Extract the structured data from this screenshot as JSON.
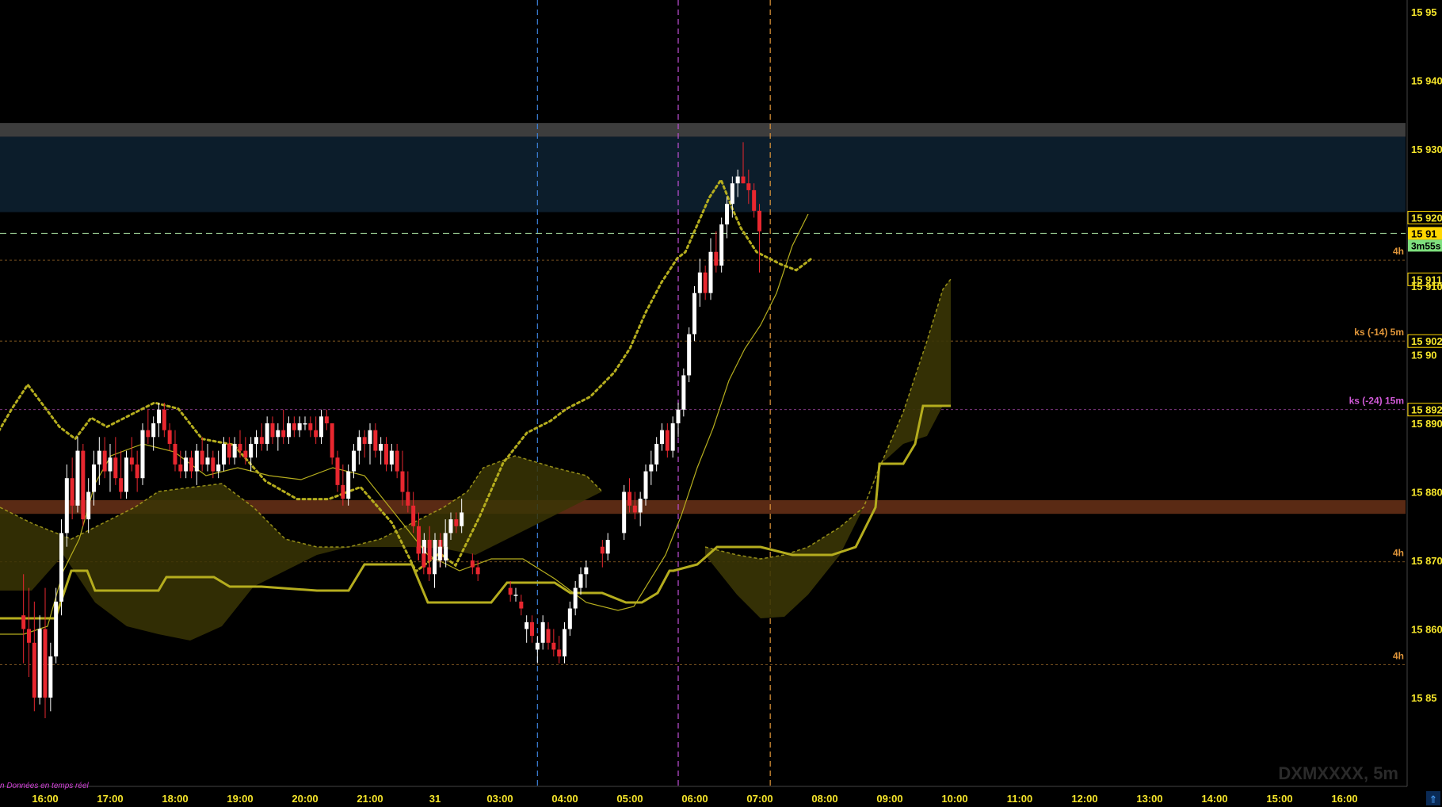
{
  "chart_data": {
    "type": "candlestick",
    "symbol_watermark": "DXMXXXX, 5m",
    "status_text": "n  Données en temps réel",
    "countdown": "3m55s",
    "colors": {
      "background": "#000000",
      "bull": "#ffffff",
      "bear": "#e8272f",
      "ichimoku": "#b5ad1e",
      "cloud": "#3a3505",
      "axis_text": "#f5e52a",
      "price_box": "#ffd700",
      "countdown_bg": "#7ee07e",
      "resistance_zone": "#0c1d2b",
      "resistance_band": "#3d3d3d",
      "support_band": "#5a2a14",
      "marker_blue": "#3b7fd6",
      "marker_magenta": "#c24fd8",
      "marker_orange": "#e0963a",
      "level_orange": "#e0963a",
      "level_magenta": "#d15ad8",
      "current_price_line": "#a8e0a0"
    },
    "y_range": [
      15843,
      15957
    ],
    "y_ticks": [
      {
        "value": 15950,
        "label": "15 95"
      },
      {
        "value": 15940,
        "label": "15 940"
      },
      {
        "value": 15930,
        "label": "15 930"
      },
      {
        "value": 15900,
        "label": "15 90"
      },
      {
        "value": 15890,
        "label": "15 890"
      },
      {
        "value": 15880,
        "label": "15 880"
      },
      {
        "value": 15870,
        "label": "15 870"
      },
      {
        "value": 15860,
        "label": "15 860"
      },
      {
        "value": 15850,
        "label": "15 85"
      }
    ],
    "x_ticks": [
      "16:00",
      "17:00",
      "18:00",
      "19:00",
      "20:00",
      "21:00",
      "31",
      "03:00",
      "04:00",
      "05:00",
      "06:00",
      "07:00",
      "08:00",
      "09:00",
      "10:00",
      "11:00",
      "12:00",
      "13:00",
      "14:00",
      "15:00",
      "16:00"
    ],
    "price_boxes": [
      {
        "value": 15920,
        "label": "15 920",
        "style": "outline"
      },
      {
        "value": 15917.7,
        "label": "15 91",
        "style": "current"
      },
      {
        "value": 15911,
        "label": "15 911",
        "style": "outline"
      },
      {
        "value": 15910,
        "label": "15 910",
        "style": "plain"
      },
      {
        "value": 15902,
        "label": "15 902",
        "style": "outline"
      },
      {
        "value": 15892,
        "label": "15 892",
        "style": "outline"
      }
    ],
    "levels": [
      {
        "value": 15913.8,
        "label": "4h",
        "color": "orange"
      },
      {
        "value": 15902,
        "label": "ks (-14) 5m",
        "color": "orange"
      },
      {
        "value": 15892,
        "label": "ks (-24) 15m",
        "color": "magenta"
      },
      {
        "value": 15869.8,
        "label": "4h",
        "color": "orange"
      },
      {
        "value": 15854.8,
        "label": "4h",
        "color": "orange"
      }
    ],
    "zones": [
      {
        "from": 15920.8,
        "to": 15931.8,
        "kind": "resistance_zone"
      },
      {
        "from": 15931.8,
        "to": 15933.8,
        "kind": "resistance_band"
      },
      {
        "from": 15876.8,
        "to": 15878.8,
        "kind": "support_band"
      }
    ],
    "vertical_markers": [
      {
        "time": "03:50",
        "color": "blue"
      },
      {
        "time": "06:00",
        "color": "magenta"
      },
      {
        "time": "07:25",
        "color": "orange"
      }
    ],
    "candles": [
      {
        "t": "15:40",
        "o": 15862,
        "h": 15868,
        "l": 15855,
        "c": 15860
      },
      {
        "t": "15:45",
        "o": 15860,
        "h": 15866,
        "l": 15853,
        "c": 15858
      },
      {
        "t": "15:50",
        "o": 15858,
        "h": 15864,
        "l": 15848,
        "c": 15850
      },
      {
        "t": "15:55",
        "o": 15850,
        "h": 15862,
        "l": 15849,
        "c": 15860
      },
      {
        "t": "16:00",
        "o": 15860,
        "h": 15866,
        "l": 15847,
        "c": 15850
      },
      {
        "t": "16:05",
        "o": 15850,
        "h": 15858,
        "l": 15848,
        "c": 15856
      },
      {
        "t": "16:10",
        "o": 15856,
        "h": 15866,
        "l": 15855,
        "c": 15864
      },
      {
        "t": "16:15",
        "o": 15864,
        "h": 15876,
        "l": 15862,
        "c": 15874
      },
      {
        "t": "16:20",
        "o": 15874,
        "h": 15884,
        "l": 15872,
        "c": 15882
      },
      {
        "t": "16:25",
        "o": 15882,
        "h": 15885,
        "l": 15876,
        "c": 15878
      },
      {
        "t": "16:30",
        "o": 15878,
        "h": 15888,
        "l": 15877,
        "c": 15886
      },
      {
        "t": "16:35",
        "o": 15886,
        "h": 15887,
        "l": 15875,
        "c": 15876
      },
      {
        "t": "16:40",
        "o": 15876,
        "h": 15882,
        "l": 15874,
        "c": 15880
      },
      {
        "t": "16:45",
        "o": 15880,
        "h": 15886,
        "l": 15878,
        "c": 15884
      },
      {
        "t": "16:50",
        "o": 15884,
        "h": 15888,
        "l": 15881,
        "c": 15886
      },
      {
        "t": "16:55",
        "o": 15886,
        "h": 15888,
        "l": 15882,
        "c": 15883
      },
      {
        "t": "17:00",
        "o": 15883,
        "h": 15887,
        "l": 15880,
        "c": 15885
      },
      {
        "t": "17:05",
        "o": 15885,
        "h": 15888,
        "l": 15881,
        "c": 15882
      },
      {
        "t": "17:10",
        "o": 15882,
        "h": 15886,
        "l": 15879,
        "c": 15880
      },
      {
        "t": "17:15",
        "o": 15880,
        "h": 15886,
        "l": 15879,
        "c": 15885
      },
      {
        "t": "17:20",
        "o": 15885,
        "h": 15888,
        "l": 15883,
        "c": 15884
      },
      {
        "t": "17:25",
        "o": 15884,
        "h": 15886,
        "l": 15880,
        "c": 15882
      },
      {
        "t": "17:30",
        "o": 15882,
        "h": 15890,
        "l": 15881,
        "c": 15889
      },
      {
        "t": "17:35",
        "o": 15889,
        "h": 15892,
        "l": 15887,
        "c": 15888
      },
      {
        "t": "17:40",
        "o": 15888,
        "h": 15891,
        "l": 15886,
        "c": 15890
      },
      {
        "t": "17:45",
        "o": 15890,
        "h": 15893,
        "l": 15888,
        "c": 15892
      },
      {
        "t": "17:50",
        "o": 15892,
        "h": 15893,
        "l": 15888,
        "c": 15889
      },
      {
        "t": "17:55",
        "o": 15889,
        "h": 15890,
        "l": 15886,
        "c": 15887
      },
      {
        "t": "18:00",
        "o": 15887,
        "h": 15889,
        "l": 15883,
        "c": 15884
      },
      {
        "t": "18:05",
        "o": 15884,
        "h": 15886,
        "l": 15882,
        "c": 15883
      },
      {
        "t": "18:10",
        "o": 15883,
        "h": 15886,
        "l": 15882,
        "c": 15885
      },
      {
        "t": "18:15",
        "o": 15885,
        "h": 15886,
        "l": 15882,
        "c": 15883
      },
      {
        "t": "18:20",
        "o": 15883,
        "h": 15887,
        "l": 15881,
        "c": 15886
      },
      {
        "t": "18:25",
        "o": 15886,
        "h": 15888,
        "l": 15883,
        "c": 15884
      },
      {
        "t": "18:30",
        "o": 15884,
        "h": 15887,
        "l": 15883,
        "c": 15885
      },
      {
        "t": "18:35",
        "o": 15885,
        "h": 15886,
        "l": 15882,
        "c": 15883
      },
      {
        "t": "18:40",
        "o": 15883,
        "h": 15886,
        "l": 15882,
        "c": 15884
      },
      {
        "t": "18:45",
        "o": 15884,
        "h": 15888,
        "l": 15883,
        "c": 15887
      },
      {
        "t": "18:50",
        "o": 15887,
        "h": 15888,
        "l": 15884,
        "c": 15885
      },
      {
        "t": "18:55",
        "o": 15885,
        "h": 15888,
        "l": 15884,
        "c": 15887
      },
      {
        "t": "19:00",
        "o": 15887,
        "h": 15889,
        "l": 15885,
        "c": 15886
      },
      {
        "t": "19:05",
        "o": 15886,
        "h": 15888,
        "l": 15884,
        "c": 15885
      },
      {
        "t": "19:10",
        "o": 15885,
        "h": 15888,
        "l": 15883,
        "c": 15887
      },
      {
        "t": "19:15",
        "o": 15887,
        "h": 15889,
        "l": 15885,
        "c": 15888
      },
      {
        "t": "19:20",
        "o": 15888,
        "h": 15890,
        "l": 15886,
        "c": 15887
      },
      {
        "t": "19:25",
        "o": 15887,
        "h": 15891,
        "l": 15886,
        "c": 15890
      },
      {
        "t": "19:30",
        "o": 15890,
        "h": 15891,
        "l": 15887,
        "c": 15888
      },
      {
        "t": "19:35",
        "o": 15888,
        "h": 15890,
        "l": 15886,
        "c": 15889
      },
      {
        "t": "19:40",
        "o": 15889,
        "h": 15892,
        "l": 15887,
        "c": 15888
      },
      {
        "t": "19:45",
        "o": 15888,
        "h": 15891,
        "l": 15887,
        "c": 15890
      },
      {
        "t": "19:50",
        "o": 15890,
        "h": 15891,
        "l": 15888,
        "c": 15889
      },
      {
        "t": "19:55",
        "o": 15889,
        "h": 15891,
        "l": 15888,
        "c": 15890
      },
      {
        "t": "20:00",
        "o": 15890,
        "h": 15891,
        "l": 15889,
        "c": 15890
      },
      {
        "t": "20:05",
        "o": 15890,
        "h": 15891,
        "l": 15888,
        "c": 15889
      },
      {
        "t": "20:10",
        "o": 15889,
        "h": 15891,
        "l": 15887,
        "c": 15888
      },
      {
        "t": "20:15",
        "o": 15888,
        "h": 15892,
        "l": 15887,
        "c": 15891
      },
      {
        "t": "20:20",
        "o": 15891,
        "h": 15892,
        "l": 15889,
        "c": 15890
      },
      {
        "t": "20:25",
        "o": 15890,
        "h": 15890,
        "l": 15884,
        "c": 15885
      },
      {
        "t": "20:30",
        "o": 15885,
        "h": 15886,
        "l": 15880,
        "c": 15881
      },
      {
        "t": "20:35",
        "o": 15881,
        "h": 15884,
        "l": 15878,
        "c": 15879
      },
      {
        "t": "20:40",
        "o": 15879,
        "h": 15884,
        "l": 15878,
        "c": 15883
      },
      {
        "t": "20:45",
        "o": 15883,
        "h": 15887,
        "l": 15882,
        "c": 15886
      },
      {
        "t": "20:50",
        "o": 15886,
        "h": 15889,
        "l": 15884,
        "c": 15888
      },
      {
        "t": "20:55",
        "o": 15888,
        "h": 15889,
        "l": 15885,
        "c": 15887
      },
      {
        "t": "21:00",
        "o": 15887,
        "h": 15890,
        "l": 15884,
        "c": 15889
      },
      {
        "t": "21:05",
        "o": 15889,
        "h": 15890,
        "l": 15885,
        "c": 15886
      },
      {
        "t": "21:10",
        "o": 15886,
        "h": 15888,
        "l": 15884,
        "c": 15887
      },
      {
        "t": "21:15",
        "o": 15887,
        "h": 15888,
        "l": 15883,
        "c": 15884
      },
      {
        "t": "21:20",
        "o": 15884,
        "h": 15887,
        "l": 15883,
        "c": 15886
      },
      {
        "t": "21:25",
        "o": 15886,
        "h": 15887,
        "l": 15882,
        "c": 15883
      },
      {
        "t": "21:30",
        "o": 15883,
        "h": 15886,
        "l": 15878,
        "c": 15880
      },
      {
        "t": "21:35",
        "o": 15880,
        "h": 15883,
        "l": 15877,
        "c": 15878
      },
      {
        "t": "21:40",
        "o": 15878,
        "h": 15880,
        "l": 15874,
        "c": 15875
      },
      {
        "t": "21:45",
        "o": 15875,
        "h": 15877,
        "l": 15870,
        "c": 15871
      },
      {
        "t": "21:50",
        "o": 15871,
        "h": 15874,
        "l": 15869,
        "c": 15873
      },
      {
        "t": "21:55",
        "o": 15873,
        "h": 15875,
        "l": 15869,
        "c": 15870
      },
      {
        "t": "22:00",
        "o": 15870,
        "h": 15874,
        "l": 15869,
        "c": 15873
      },
      {
        "t": "22:05",
        "o": 15873,
        "h": 15874,
        "l": 15869,
        "c": 15870
      },
      {
        "t": "22:10",
        "o": 15870,
        "h": 15873,
        "l": 15869,
        "c": 15872
      },
      {
        "t": "02:00",
        "o": 15872,
        "h": 15874,
        "l": 15870,
        "c": 15871
      },
      {
        "t": "02:05",
        "o": 15871,
        "h": 15872,
        "l": 15868,
        "c": 15869
      },
      {
        "t": "02:10",
        "o": 15869,
        "h": 15871,
        "l": 15867,
        "c": 15868
      },
      {
        "t": "02:15",
        "o": 15868,
        "h": 15871,
        "l": 15866,
        "c": 15870
      },
      {
        "t": "02:20",
        "o": 15870,
        "h": 15873,
        "l": 15869,
        "c": 15872
      },
      {
        "t": "02:25",
        "o": 15872,
        "h": 15876,
        "l": 15871,
        "c": 15874
      },
      {
        "t": "02:30",
        "o": 15874,
        "h": 15877,
        "l": 15873,
        "c": 15876
      },
      {
        "t": "02:35",
        "o": 15876,
        "h": 15877,
        "l": 15874,
        "c": 15875
      },
      {
        "t": "02:40",
        "o": 15875,
        "h": 15879,
        "l": 15874,
        "c": 15877
      },
      {
        "t": "02:50",
        "o": 15870,
        "h": 15871,
        "l": 15868,
        "c": 15869
      },
      {
        "t": "02:55",
        "o": 15869,
        "h": 15870,
        "l": 15867,
        "c": 15868
      },
      {
        "t": "03:25",
        "o": 15866,
        "h": 15867,
        "l": 15864,
        "c": 15865
      },
      {
        "t": "03:30",
        "o": 15865,
        "h": 15866,
        "l": 15864,
        "c": 15865
      },
      {
        "t": "03:35",
        "o": 15864,
        "h": 15865,
        "l": 15862,
        "c": 15863
      },
      {
        "t": "03:40",
        "o": 15860,
        "h": 15862,
        "l": 15858,
        "c": 15861
      },
      {
        "t": "03:45",
        "o": 15861,
        "h": 15862,
        "l": 15858,
        "c": 15859
      },
      {
        "t": "03:50",
        "o": 15857,
        "h": 15859,
        "l": 15855,
        "c": 15858
      },
      {
        "t": "03:55",
        "o": 15858,
        "h": 15862,
        "l": 15857,
        "c": 15861
      },
      {
        "t": "04:00",
        "o": 15860,
        "h": 15861,
        "l": 15857,
        "c": 15858
      },
      {
        "t": "04:05",
        "o": 15858,
        "h": 15860,
        "l": 15856,
        "c": 15857
      },
      {
        "t": "04:10",
        "o": 15857,
        "h": 15859,
        "l": 15855,
        "c": 15856
      },
      {
        "t": "04:15",
        "o": 15856,
        "h": 15861,
        "l": 15855,
        "c": 15860
      },
      {
        "t": "04:20",
        "o": 15860,
        "h": 15864,
        "l": 15859,
        "c": 15863
      },
      {
        "t": "04:25",
        "o": 15863,
        "h": 15867,
        "l": 15862,
        "c": 15866
      },
      {
        "t": "04:30",
        "o": 15866,
        "h": 15869,
        "l": 15865,
        "c": 15868
      },
      {
        "t": "04:35",
        "o": 15868,
        "h": 15870,
        "l": 15866,
        "c": 15869
      },
      {
        "t": "04:50",
        "o": 15872,
        "h": 15873,
        "l": 15869,
        "c": 15871
      },
      {
        "t": "04:55",
        "o": 15871,
        "h": 15874,
        "l": 15870,
        "c": 15873
      },
      {
        "t": "05:10",
        "o": 15874,
        "h": 15881,
        "l": 15873,
        "c": 15880
      },
      {
        "t": "05:15",
        "o": 15880,
        "h": 15882,
        "l": 15877,
        "c": 15878
      },
      {
        "t": "05:20",
        "o": 15878,
        "h": 15880,
        "l": 15876,
        "c": 15877
      },
      {
        "t": "05:25",
        "o": 15877,
        "h": 15880,
        "l": 15875,
        "c": 15879
      },
      {
        "t": "05:30",
        "o": 15879,
        "h": 15884,
        "l": 15878,
        "c": 15883
      },
      {
        "t": "05:35",
        "o": 15883,
        "h": 15886,
        "l": 15881,
        "c": 15884
      },
      {
        "t": "05:40",
        "o": 15884,
        "h": 15888,
        "l": 15883,
        "c": 15887
      },
      {
        "t": "05:45",
        "o": 15887,
        "h": 15890,
        "l": 15886,
        "c": 15889
      },
      {
        "t": "05:50",
        "o": 15889,
        "h": 15890,
        "l": 15885,
        "c": 15886
      },
      {
        "t": "05:55",
        "o": 15886,
        "h": 15891,
        "l": 15885,
        "c": 15890
      },
      {
        "t": "06:00",
        "o": 15890,
        "h": 15893,
        "l": 15888,
        "c": 15892
      },
      {
        "t": "06:05",
        "o": 15892,
        "h": 15898,
        "l": 15891,
        "c": 15897
      },
      {
        "t": "06:10",
        "o": 15897,
        "h": 15904,
        "l": 15896,
        "c": 15903
      },
      {
        "t": "06:15",
        "o": 15903,
        "h": 15910,
        "l": 15902,
        "c": 15909
      },
      {
        "t": "06:20",
        "o": 15909,
        "h": 15914,
        "l": 15907,
        "c": 15912
      },
      {
        "t": "06:25",
        "o": 15912,
        "h": 15913,
        "l": 15908,
        "c": 15909
      },
      {
        "t": "06:30",
        "o": 15909,
        "h": 15917,
        "l": 15908,
        "c": 15915
      },
      {
        "t": "06:35",
        "o": 15915,
        "h": 15918,
        "l": 15912,
        "c": 15913
      },
      {
        "t": "06:40",
        "o": 15913,
        "h": 15920,
        "l": 15912,
        "c": 15919
      },
      {
        "t": "06:45",
        "o": 15919,
        "h": 15923,
        "l": 15917,
        "c": 15922
      },
      {
        "t": "06:50",
        "o": 15922,
        "h": 15926,
        "l": 15920,
        "c": 15925
      },
      {
        "t": "06:55",
        "o": 15925,
        "h": 15927,
        "l": 15923,
        "c": 15926
      },
      {
        "t": "07:00",
        "o": 15926,
        "h": 15931,
        "l": 15925,
        "c": 15925
      },
      {
        "t": "07:05",
        "o": 15925,
        "h": 15927,
        "l": 15922,
        "c": 15924
      },
      {
        "t": "07:10",
        "o": 15924,
        "h": 15925,
        "l": 15920,
        "c": 15921
      },
      {
        "t": "07:15",
        "o": 15921,
        "h": 15922,
        "l": 15912,
        "c": 15918
      }
    ],
    "ichimoku_note": "Ichimoku lines and cloud drawn by script"
  }
}
